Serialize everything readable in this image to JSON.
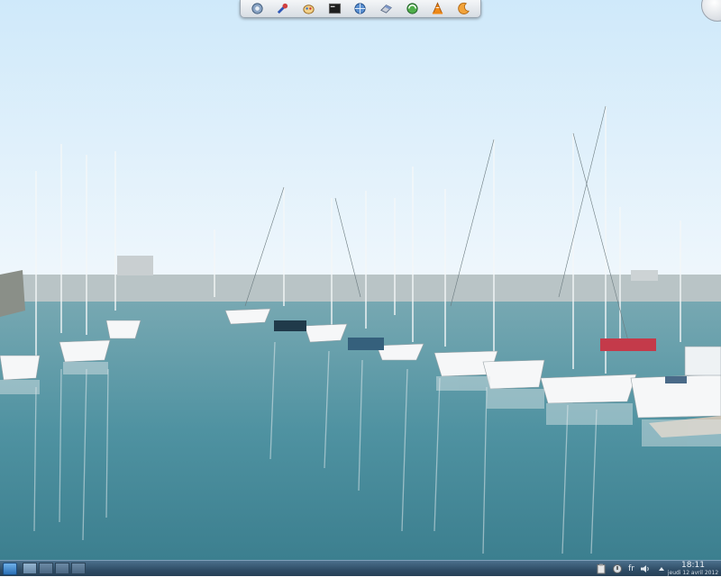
{
  "desktop": {
    "wallpaper": "harbor-marina-photo",
    "colors": {
      "sky_top": "#d4ecfa",
      "sky_bottom": "#f1f8fd",
      "water_top": "#6fa3b0",
      "water_bottom": "#3e8193"
    }
  },
  "dock": {
    "launchers": [
      {
        "icon": "system-settings-icon"
      },
      {
        "icon": "tools-icon"
      },
      {
        "icon": "paint-icon"
      },
      {
        "icon": "terminal-icon"
      },
      {
        "icon": "network-icon"
      },
      {
        "icon": "eraser-icon"
      },
      {
        "icon": "browser-icon"
      },
      {
        "icon": "vlc-cone-icon"
      },
      {
        "icon": "moon-icon"
      }
    ]
  },
  "panel": {
    "desktops": [
      "1",
      "2",
      "3",
      "4"
    ],
    "active_desktop": 0,
    "tray": {
      "language": "fr"
    },
    "clock": {
      "time": "18:11",
      "date": "jeudi 12 avril 2012"
    }
  }
}
